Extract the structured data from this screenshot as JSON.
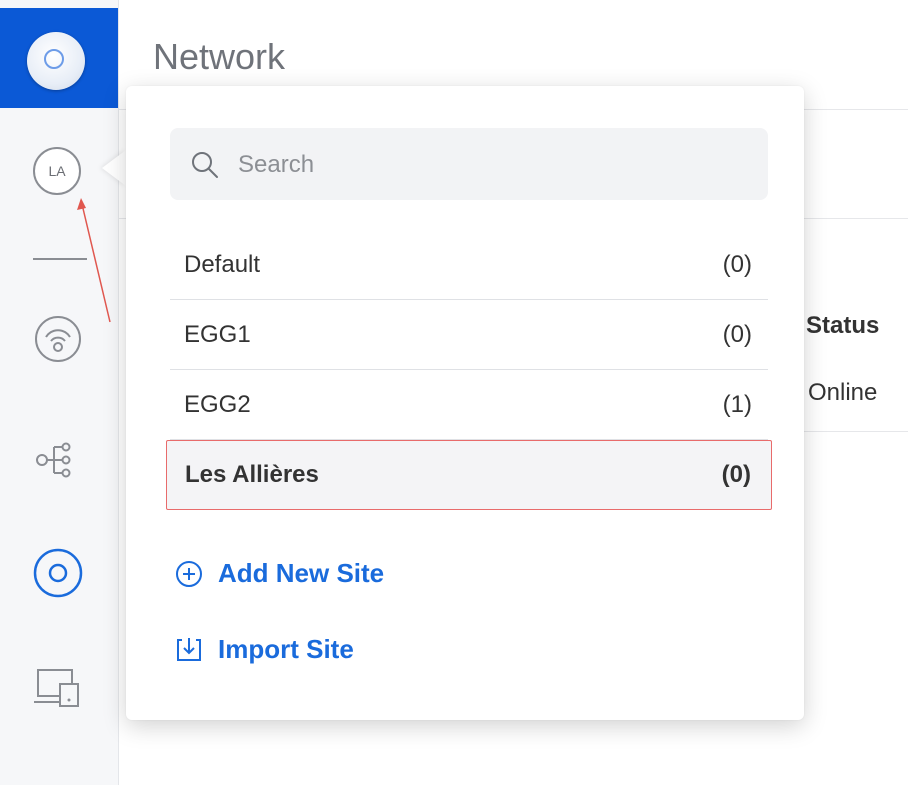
{
  "header": {
    "title": "Network"
  },
  "sidebar": {
    "site_initials": "LA",
    "icons": [
      "app-logo-icon",
      "site-switcher",
      "wifi-icon",
      "topology-icon",
      "access-point-icon",
      "devices-icon"
    ]
  },
  "site_dropdown": {
    "search_placeholder": "Search",
    "sites": [
      {
        "name": "Default",
        "count": "(0)"
      },
      {
        "name": "EGG1",
        "count": "(0)"
      },
      {
        "name": "EGG2",
        "count": "(1)"
      },
      {
        "name": "Les Allières",
        "count": "(0)",
        "selected": true
      }
    ],
    "add_site_label": "Add New Site",
    "import_site_label": "Import Site"
  },
  "table": {
    "status_header": "Status",
    "status_value": "Online"
  },
  "colors": {
    "brand_blue": "#0b59d6",
    "link_blue": "#1a6bdc",
    "highlight_red": "#e86b6b",
    "annotation_arrow": "#e0574f"
  }
}
